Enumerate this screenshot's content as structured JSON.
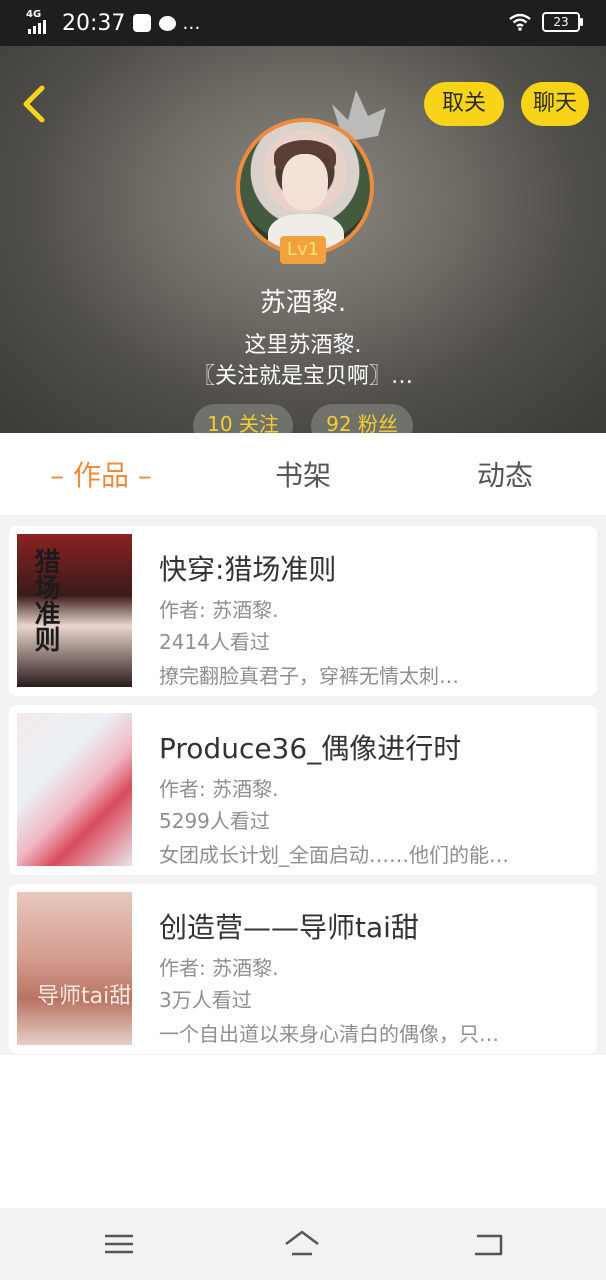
{
  "status_bar": {
    "network": "4G",
    "time": "20:37",
    "more": "…",
    "battery": "23"
  },
  "header": {
    "unfollow_label": "取关",
    "chat_label": "聊天",
    "level": "Lv1",
    "username": "苏酒黎.",
    "bio_line1": "这里苏酒黎.",
    "bio_line2": "〖关注就是宝贝啊〗…",
    "follow_stat": "10 关注",
    "fans_stat": "92 粉丝"
  },
  "tabs": [
    {
      "label": "作品",
      "active": true
    },
    {
      "label": "书架",
      "active": false
    },
    {
      "label": "动态",
      "active": false
    }
  ],
  "works": [
    {
      "title": "快穿:猎场准则",
      "author": "作者: 苏酒黎.",
      "views": "2414人看过",
      "desc": "撩完翻脸真君子，穿裤无情太刺…",
      "cover_text": "猎场准则"
    },
    {
      "title": "Produce36_偶像进行时",
      "author": "作者: 苏酒黎.",
      "views": "5299人看过",
      "desc": "女团成长计划_全面启动……他们的能…"
    },
    {
      "title": "创造营——导师tai甜",
      "author": "作者: 苏酒黎.",
      "views": "3万人看过",
      "desc": "一个自出道以来身心清白的偶像，只…",
      "cover_text": "导师tai甜"
    }
  ],
  "colors": {
    "accent_orange": "#ef8b3e",
    "button_yellow": "#f7d417",
    "stat_yellow": "#f5cf2a"
  },
  "icons": [
    "back-chevron-icon",
    "crown-icon",
    "menu-icon",
    "home-icon",
    "back-icon"
  ]
}
